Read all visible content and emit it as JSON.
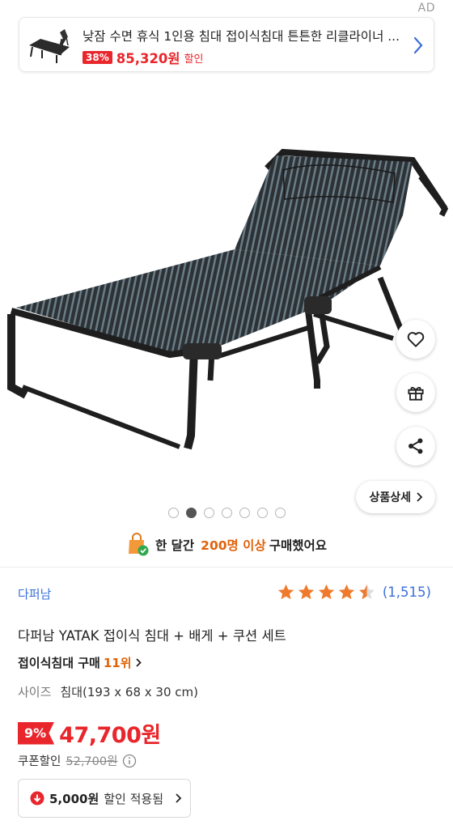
{
  "ad": {
    "label": "AD",
    "title": "낮잠 수면 휴식 1인용 침대 접이식침대 튼튼한 리클라이너 ...",
    "discount": "38%",
    "price": "85,320원",
    "sale_label": "할인"
  },
  "gallery": {
    "total_images": 7,
    "current_index": 2
  },
  "actions": {
    "detail_label": "상품상세"
  },
  "purchase": {
    "prefix": "한 달간",
    "highlight": "200명 이상",
    "suffix": "구매했어요"
  },
  "product": {
    "brand": "다퍼남",
    "rating": 4.5,
    "review_count": "(1,515)",
    "title": "다퍼남 YATAK 접이식 침대 + 배게 + 쿠션 세트",
    "rank_label": "접이식침대 구매",
    "rank_value": "11위",
    "option_label": "사이즈",
    "option_value": "침대(193 x 68 x 30 cm)"
  },
  "price": {
    "discount_pct": "9%",
    "final": "47,700원",
    "coupon_label": "쿠폰할인",
    "original": "52,700원"
  },
  "coupon": {
    "amount": "5,000원",
    "applied_label": "할인 적용됨"
  },
  "colors": {
    "accent_red": "#e8262c",
    "accent_orange": "#e0620a",
    "link_blue": "#3a6fd8",
    "star_orange": "#f07a2c"
  }
}
